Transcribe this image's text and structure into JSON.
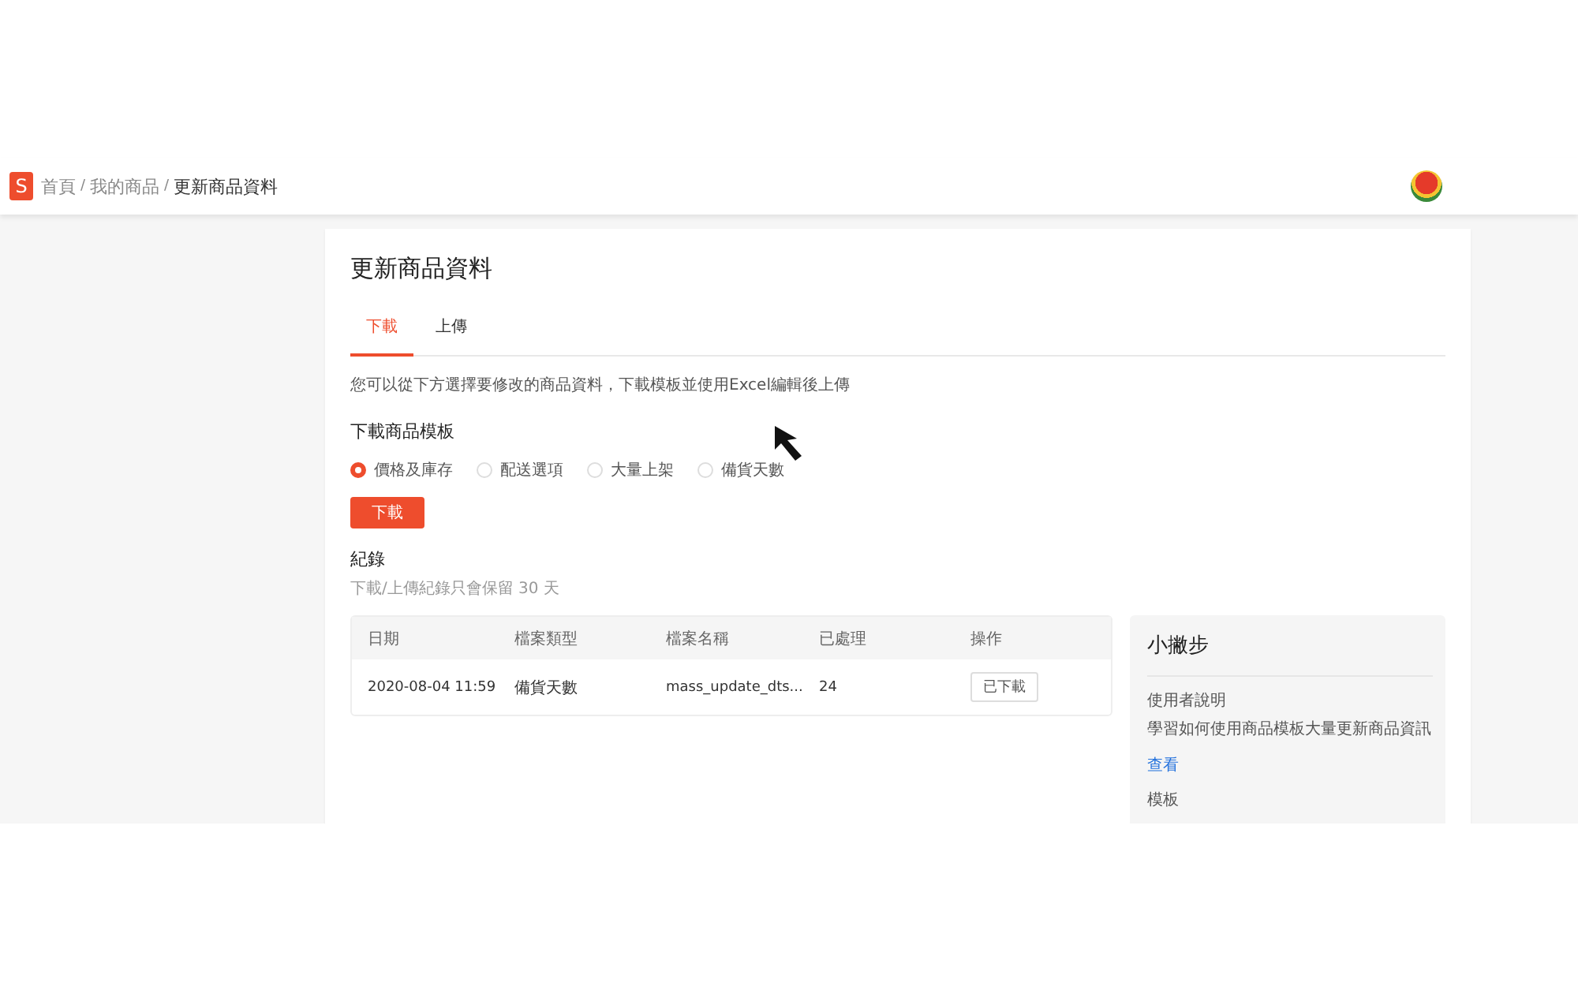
{
  "header": {
    "logo_letter": "S",
    "breadcrumb": [
      {
        "label": "首頁",
        "current": false
      },
      {
        "separator": "/",
        "label": "我的商品",
        "current": false
      },
      {
        "separator": "/",
        "label": "更新商品資料",
        "current": true
      }
    ]
  },
  "page_title": "更新商品資料",
  "tabs": [
    {
      "label": "下載",
      "selected": true
    },
    {
      "label": "上傳",
      "selected": false
    }
  ],
  "description": "您可以從下方選擇要修改的商品資料，下載模板並使用Excel編輯後上傳",
  "template_section": {
    "title": "下載商品模板",
    "options": [
      {
        "label": "價格及庫存",
        "selected": true
      },
      {
        "label": "配送選項",
        "selected": false
      },
      {
        "label": "大量上架",
        "selected": false
      },
      {
        "label": "備貨天數",
        "selected": false
      }
    ],
    "button": "下載"
  },
  "records": {
    "title": "紀錄",
    "note": "下載/上傳紀錄只會保留 30 天",
    "columns": [
      "日期",
      "檔案類型",
      "檔案名稱",
      "已處理",
      "操作"
    ],
    "rows": [
      {
        "date": "2020-08-04 11:59",
        "type": "備貨天數",
        "file": "mass_update_dts...",
        "processed": "24",
        "action": "已下載"
      }
    ]
  },
  "tips": {
    "title": "小撇步",
    "guide_title": "使用者說明",
    "guide_text": "學習如何使用商品模板大量更新商品資訊",
    "guide_link": "查看",
    "template_title": "模板"
  }
}
